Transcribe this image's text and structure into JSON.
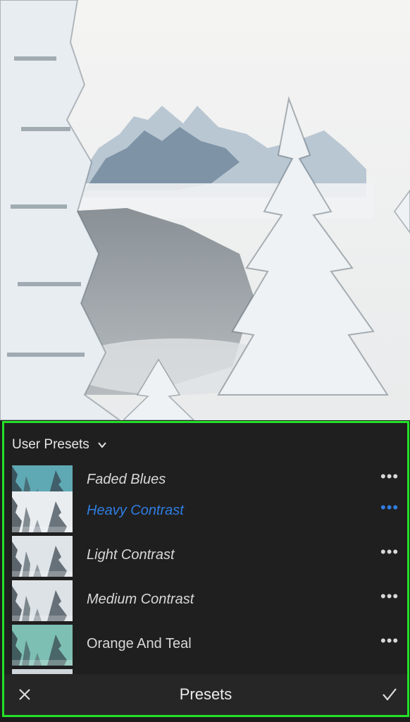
{
  "panel": {
    "group_label": "User Presets",
    "footer_title": "Presets"
  },
  "presets": [
    {
      "label": "Faded Blues",
      "tint": "#5fa9b4",
      "style": "italic",
      "active": false
    },
    {
      "label": "Heavy Contrast",
      "tint": "#e9edf0",
      "style": "italic",
      "active": true
    },
    {
      "label": "Light Contrast",
      "tint": "#dfe4e8",
      "style": "italic",
      "active": false
    },
    {
      "label": "Medium Contrast",
      "tint": "#dde2e6",
      "style": "italic",
      "active": false
    },
    {
      "label": "Orange And Teal",
      "tint": "#7dbfb3",
      "style": "normal",
      "active": false
    }
  ],
  "colors": {
    "accent": "#2f7de1",
    "highlight_border": "#25e028",
    "panel_bg": "#1f1f1f"
  },
  "icons": {
    "dropdown": "chevron-down-icon",
    "more": "more-dots-icon",
    "cancel": "close-icon",
    "confirm": "checkmark-icon"
  }
}
